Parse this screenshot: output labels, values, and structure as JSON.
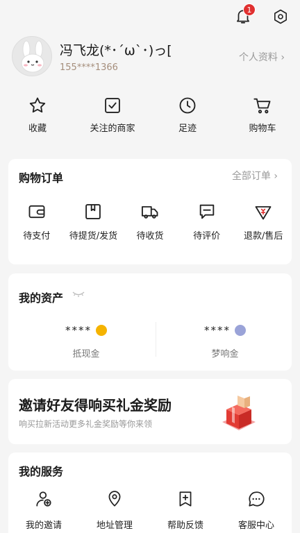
{
  "header": {
    "notification_count": "1",
    "icons": [
      "bell-icon",
      "settings-icon"
    ]
  },
  "profile": {
    "name": "冯飞龙(*･´ω`･)っ[",
    "phone": "155****1366",
    "link_label": "个人资料 ›"
  },
  "quick_links": [
    {
      "label": "收藏",
      "icon": "star-icon"
    },
    {
      "label": "关注的商家",
      "icon": "checkbox-icon"
    },
    {
      "label": "足迹",
      "icon": "clock-icon"
    },
    {
      "label": "购物车",
      "icon": "cart-icon"
    }
  ],
  "orders": {
    "title": "购物订单",
    "all_label": "全部订单 ›",
    "items": [
      {
        "label": "待支付",
        "icon": "wallet-icon"
      },
      {
        "label": "待提货/发货",
        "icon": "package-icon"
      },
      {
        "label": "待收货",
        "icon": "truck-icon"
      },
      {
        "label": "待评价",
        "icon": "comment-icon"
      },
      {
        "label": "退款/售后",
        "icon": "refund-icon"
      }
    ]
  },
  "assets": {
    "title": "我的资产",
    "items": [
      {
        "value": "****",
        "label": "抵现金",
        "coin_color": "#f5b300"
      },
      {
        "value": "****",
        "label": "梦响金",
        "coin_color": "#9aa3d8"
      }
    ]
  },
  "invite": {
    "title": "邀请好友得响买礼金奖励",
    "subtitle": "响买拉新活动更多礼金奖励等你来领"
  },
  "services": {
    "title": "我的服务",
    "items": [
      {
        "label": "我的邀请",
        "icon": "user-plus-icon"
      },
      {
        "label": "地址管理",
        "icon": "location-icon"
      },
      {
        "label": "帮助反馈",
        "icon": "bookmark-icon"
      },
      {
        "label": "客服中心",
        "icon": "chat-icon"
      }
    ]
  },
  "colors": {
    "badge": "#e0302f",
    "accent_text": "#a58e7c",
    "background": "#f5f5f5"
  }
}
